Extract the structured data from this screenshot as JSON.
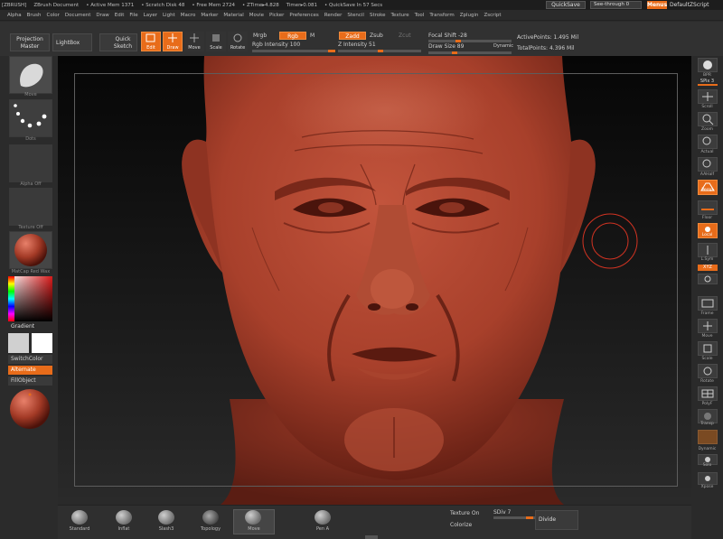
{
  "titlebar": {
    "app": "[ZBRUSH]",
    "doc": "ZBrush Document",
    "active_mem": "• Active Mem 1371",
    "scratch": "• Scratch Disk 48",
    "free_mem": "• Free Mem 2724",
    "ztime": "• ZTime▸4.828",
    "timer": "Timer▸0.081",
    "quicksave_info": "• QuickSave In 57 Secs",
    "quicksave_btn": "QuickSave",
    "seethrough": "See-through 0",
    "menus_btn": "Menus",
    "default_script": "DefaultZScript"
  },
  "menubar": [
    "Alpha",
    "Brush",
    "Color",
    "Document",
    "Draw",
    "Edit",
    "File",
    "Layer",
    "Light",
    "Macro",
    "Marker",
    "Material",
    "Movie",
    "Picker",
    "Preferences",
    "Render",
    "Stencil",
    "Stroke",
    "Texture",
    "Tool",
    "Transform",
    "Zplugin",
    "Zscript"
  ],
  "toolbar": {
    "projection_master": "Projection Master",
    "lightbox": "LightBox",
    "quick_sketch": "Quick Sketch",
    "edit": "Edit",
    "draw": "Draw",
    "move": "Move",
    "scale": "Scale",
    "rotate": "Rotate",
    "mrgb": "Mrgb",
    "rgb": "Rgb",
    "m": "M",
    "zadd": "Zadd",
    "zsub": "Zsub",
    "zcut": "Zcut",
    "rgb_intensity": "Rgb Intensity 100",
    "z_intensity": "Z Intensity 51",
    "focal_shift": "Focal Shift -28",
    "draw_size": "Draw Size 89",
    "dynamic": "Dynamic",
    "active_points": "ActivePoints: 1.495 Mil",
    "total_points": "TotalPoints: 4.396 Mil",
    "z_intensity_value": 51,
    "draw_size_value": 89
  },
  "leftpanel": {
    "brush_label": "Move",
    "stroke_label": "Dots",
    "alpha_label": "Alpha Off",
    "texture_label": "Texture Off",
    "material_label": "MatCap Red Wax",
    "gradient": "Gradient",
    "switchcolor": "SwitchColor",
    "alternate": "Alternate",
    "fillobject": "FillObject"
  },
  "rightpanel": {
    "bpr": "BPR",
    "spix": "SPix 3",
    "scroll": "Scroll",
    "zoom": "Zoom",
    "actual": "Actual",
    "aahalf": "AAHalf",
    "persp": "Persp",
    "floor": "Floor",
    "local": "Local",
    "lsym": "L.Sym",
    "xyz": "XYZ",
    "frame": "Frame",
    "move": "Move",
    "scale": "Scale",
    "rotate": "Rotate",
    "polyf": "PolyF",
    "transp": "Transp",
    "dynamic": "Dynamic",
    "solo": "Solo",
    "xpose": "Xpose"
  },
  "bottombar": {
    "brushes": [
      "Standard",
      "Inflat",
      "Slash3",
      "Topology",
      "Move",
      "Pen A"
    ],
    "texture_on": "Texture On",
    "sdiv": "SDiv 7",
    "colorize": "Colorize",
    "divide": "Divide"
  },
  "colors": {
    "accent": "#e86c1a",
    "skin": "#b0442e",
    "canvas_bg": "#0a0a0a"
  }
}
